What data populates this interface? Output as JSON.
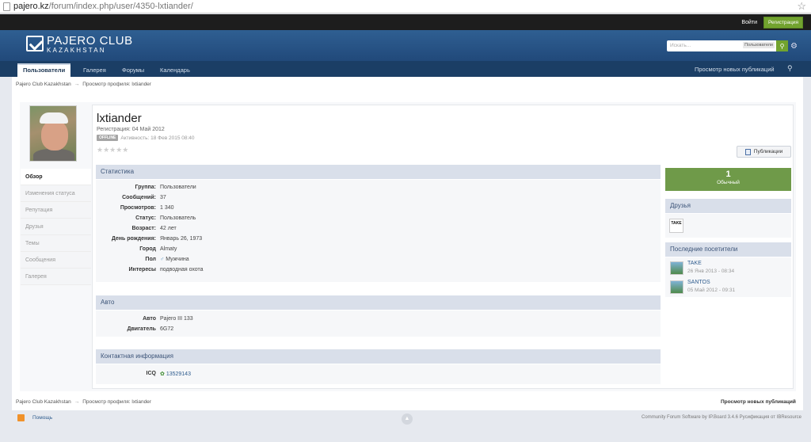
{
  "browser": {
    "url_host": "pajero.kz",
    "url_path": "/forum/index.php/user/4350-lxtiander/"
  },
  "userbar": {
    "login": "Войти",
    "register": "Регистрация"
  },
  "brand": {
    "title": "PAJERO CLUB",
    "subtitle": "KAZAKHSTAN"
  },
  "search": {
    "placeholder": "Искать...",
    "scope": "Пользователи"
  },
  "nav": {
    "tabs": [
      "Пользователи",
      "Галерея",
      "Форумы",
      "Календарь"
    ],
    "active": "Пользователи",
    "new_posts": "Просмотр новых публикаций"
  },
  "breadcrumb": {
    "root": "Pajero Club Kazakhstan",
    "arrow": "→",
    "current": "Просмотр профиля: lxtiander"
  },
  "profile": {
    "name": "lxtiander",
    "registered": "Регистрация: 04 Май 2012",
    "status_badge": "OFFLINE",
    "activity": "Активность: 18 Фев 2015 08:40",
    "rating_stars": "★★★★★",
    "publications_button": "Публикации"
  },
  "sidebar_menu": [
    "Обзор",
    "Изменения статуса",
    "Репутация",
    "Друзья",
    "Темы",
    "Сообщения",
    "Галерея"
  ],
  "sections": {
    "stats": {
      "title": "Статистика",
      "rows": [
        {
          "k": "Группа:",
          "v": "Пользователи"
        },
        {
          "k": "Сообщений:",
          "v": "37"
        },
        {
          "k": "Просмотров:",
          "v": "1 340"
        },
        {
          "k": "Статус:",
          "v": "Пользователь"
        },
        {
          "k": "Возраст:",
          "v": "42 лет"
        },
        {
          "k": "День рождения:",
          "v": "Январь 26, 1973"
        },
        {
          "k": "Город",
          "v": "Almaty"
        },
        {
          "k": "Пол",
          "v": "Мужчина"
        },
        {
          "k": "Интересы",
          "v": "подводная охота"
        }
      ]
    },
    "auto": {
      "title": "Авто",
      "rows": [
        {
          "k": "Авто",
          "v": "Pajero III 133"
        },
        {
          "k": "Двигатель",
          "v": "6G72"
        }
      ]
    },
    "contacts": {
      "title": "Контактная информация",
      "rows": [
        {
          "k": "ICQ",
          "v": "13529143"
        }
      ]
    }
  },
  "rank": {
    "number": "1",
    "label": "Обычный"
  },
  "friends": {
    "title": "Друзья",
    "avatar_text": "TAKE"
  },
  "visitors": {
    "title": "Последние посетители",
    "items": [
      {
        "name": "TAKE",
        "date": "26 Янв 2013 - 08:34"
      },
      {
        "name": "SANTOS",
        "date": "05 Май 2012 - 09:31"
      }
    ]
  },
  "footer": {
    "help": "Помощь",
    "copyright": "Community Forum Software by IP.Board 3.4.6 Русификация от IBResource",
    "new_posts": "Просмотр новых публикаций"
  },
  "colors": {
    "header": "#2f5f92",
    "nav": "#1b3e65",
    "accent_green": "#72a32f",
    "rank_green": "#6f9a49",
    "section_head": "#d9dfea"
  }
}
